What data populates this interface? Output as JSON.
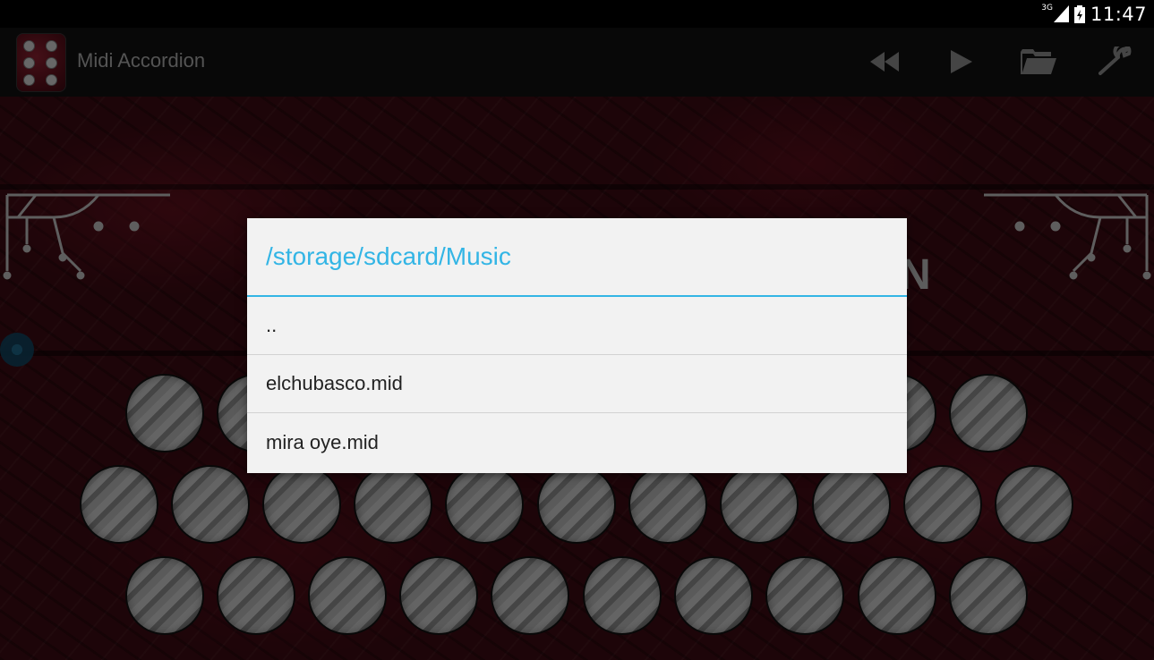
{
  "status_bar": {
    "network": "3G",
    "time": "11:47",
    "icons": [
      "signal-icon",
      "battery-icon"
    ]
  },
  "action_bar": {
    "app_title": "Midi Accordion",
    "actions": [
      "rewind-icon",
      "play-icon",
      "folder-icon",
      "wrench-icon"
    ]
  },
  "background": {
    "logo_fragment": "N"
  },
  "dialog": {
    "title": "/storage/sdcard/Music",
    "items": [
      "..",
      "elchubasco.mid",
      "mira oye.mid"
    ]
  },
  "colors": {
    "accent": "#33b5e5",
    "dialog_bg": "#f2f2f2",
    "action_bar_bg": "#101010",
    "title_text": "#a9a9a9"
  }
}
